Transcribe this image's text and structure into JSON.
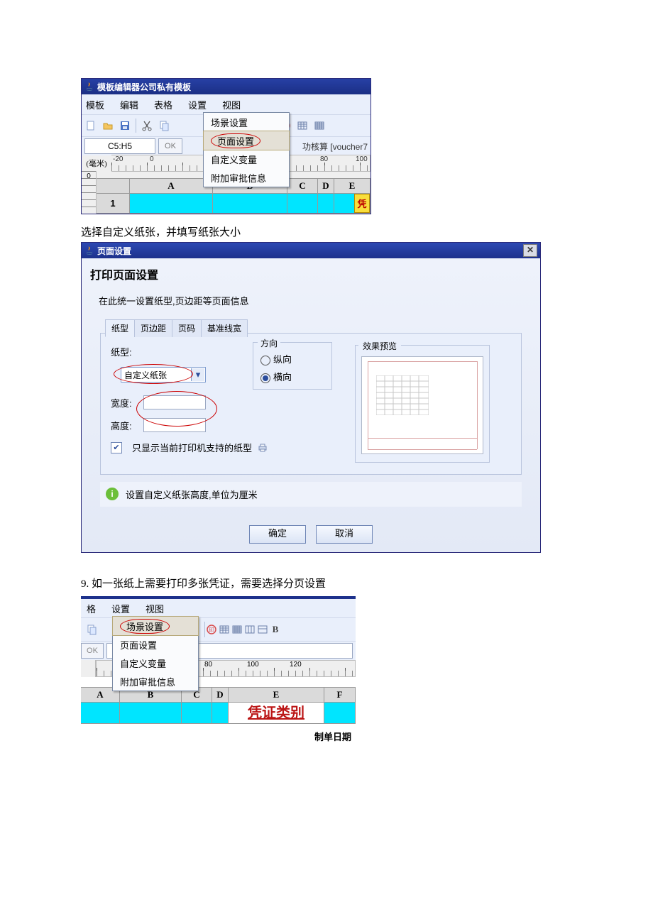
{
  "win1": {
    "title": "模板编辑器公司私有模板",
    "menus": [
      "模板",
      "编辑",
      "表格",
      "设置",
      "视图"
    ],
    "popup": [
      "场景设置",
      "页面设置",
      "自定义变量",
      "附加审批信息"
    ],
    "popup_highlight_index": 1,
    "cell_ref": "C5:H5",
    "ok": "OK",
    "right_text": "功核算  [voucher7",
    "ruler_unit": "(毫米)",
    "ruler_ticks": [
      "-20",
      "0",
      "80",
      "100"
    ],
    "ruler_v_tick": "0",
    "col_headers": [
      "A",
      "B",
      "C",
      "D",
      "E"
    ],
    "row_header": "1",
    "badge": "凭"
  },
  "caption1": "选择自定义纸张，并填写纸张大小",
  "dialog": {
    "title": "页面设置",
    "heading": "打印页面设置",
    "subheading": "在此统一设置纸型,页边距等页面信息",
    "tabs": [
      "纸型",
      "页边距",
      "页码",
      "基准线宽"
    ],
    "paper_label": "纸型:",
    "paper_value": "自定义纸张",
    "direction_label": "方向",
    "direction_opts": [
      "纵向",
      "横向"
    ],
    "direction_selected": 1,
    "width_label": "宽度:",
    "width_value": "",
    "height_label": "高度:",
    "height_value": "",
    "checkbox_label": "只显示当前打印机支持的纸型",
    "checkbox_checked": true,
    "preview_label": "效果预览",
    "hint": "设置自定义纸张高度,单位为厘米",
    "ok_btn": "确定",
    "cancel_btn": "取消"
  },
  "step9": "9.    如一张纸上需要打印多张凭证，需要选择分页设置",
  "win3": {
    "menus": [
      "格",
      "设置",
      "视图"
    ],
    "popup": [
      "场景设置",
      "页面设置",
      "自定义变量",
      "附加审批信息"
    ],
    "popup_highlight_index": 0,
    "ok": "OK",
    "ruler_ticks": [
      "80",
      "100",
      "120"
    ],
    "col_headers": [
      "A",
      "B",
      "C",
      "D",
      "E",
      "F"
    ],
    "voucher_type": "凭证类别",
    "date_label": "制单日期"
  }
}
